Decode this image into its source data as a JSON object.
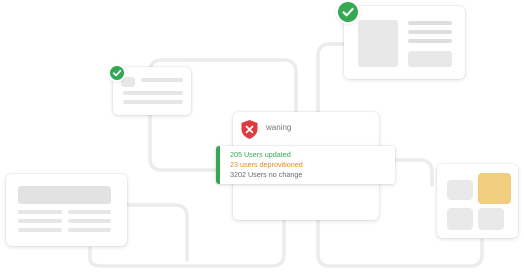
{
  "dialog": {
    "title": "waning"
  },
  "status_panel": {
    "lines": [
      {
        "text": "205 Users updated",
        "color": "#34a853"
      },
      {
        "text": "23 users deprovitioned",
        "color": "#e08a1e"
      },
      {
        "text": "3202 Users no change",
        "color": "#6b6b6b"
      }
    ],
    "accent_color": "#34a853"
  },
  "colors": {
    "success": "#34a853",
    "warning": "#e08a1e",
    "error": "#e0393e",
    "connector": "#ececec",
    "tile_highlight": "#f0cd7f",
    "tile_neutral": "#e9e9e9"
  },
  "icons": {
    "check": "check-icon",
    "shield_error": "shield-x-icon"
  }
}
